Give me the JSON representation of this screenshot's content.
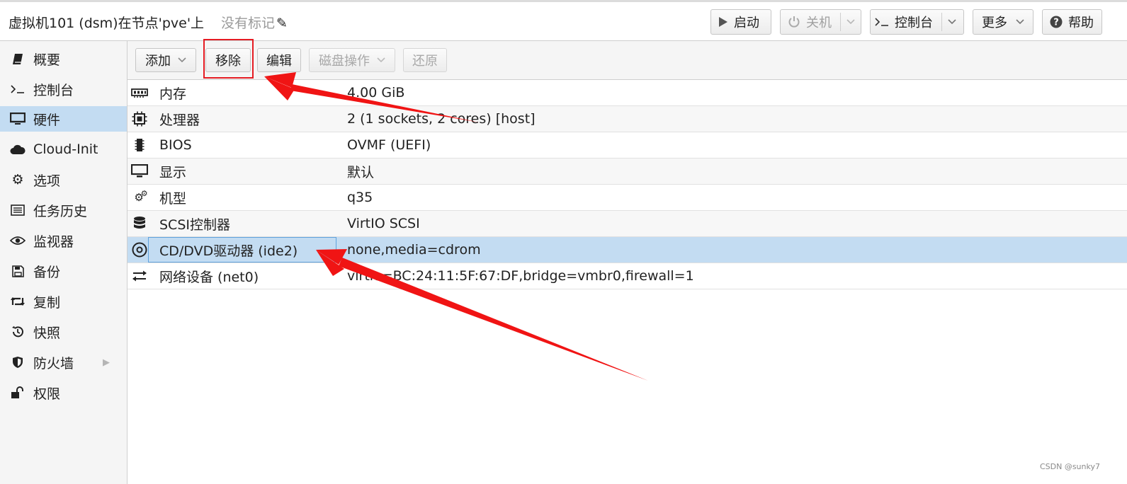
{
  "header": {
    "title": "虚拟机101 (dsm)在节点'pve'上",
    "tags_label": "没有标记",
    "buttons": {
      "start": "启动",
      "shutdown": "关机",
      "console": "控制台",
      "more": "更多",
      "help": "帮助"
    }
  },
  "sidebar": {
    "items": [
      {
        "label": "概要",
        "icon": "book-icon"
      },
      {
        "label": "控制台",
        "icon": "terminal-icon"
      },
      {
        "label": "硬件",
        "icon": "monitor-icon"
      },
      {
        "label": "Cloud-Init",
        "icon": "cloud-icon"
      },
      {
        "label": "选项",
        "icon": "gear-icon"
      },
      {
        "label": "任务历史",
        "icon": "list-icon"
      },
      {
        "label": "监视器",
        "icon": "eye-icon"
      },
      {
        "label": "备份",
        "icon": "floppy-icon"
      },
      {
        "label": "复制",
        "icon": "retweet-icon"
      },
      {
        "label": "快照",
        "icon": "history-icon"
      },
      {
        "label": "防火墙",
        "icon": "shield-icon"
      },
      {
        "label": "权限",
        "icon": "unlock-icon"
      }
    ],
    "active_index": 2
  },
  "toolbar": {
    "add": "添加",
    "remove": "移除",
    "edit": "编辑",
    "disk_action": "磁盘操作",
    "revert": "还原"
  },
  "hardware": [
    {
      "key": "内存",
      "value": "4.00 GiB",
      "icon": "memory-icon"
    },
    {
      "key": "处理器",
      "value": "2 (1 sockets, 2 cores) [host]",
      "icon": "cpu-icon"
    },
    {
      "key": "BIOS",
      "value": "OVMF (UEFI)",
      "icon": "microchip-icon"
    },
    {
      "key": "显示",
      "value": "默认",
      "icon": "desktop-icon"
    },
    {
      "key": "机型",
      "value": "q35",
      "icon": "cogs-icon"
    },
    {
      "key": "SCSI控制器",
      "value": "VirtIO SCSI",
      "icon": "database-icon"
    },
    {
      "key": "CD/DVD驱动器 (ide2)",
      "value": "none,media=cdrom",
      "icon": "cdrom-icon"
    },
    {
      "key": "网络设备 (net0)",
      "value": "virtio=BC:24:11:5F:67:DF,bridge=vmbr0,firewall=1",
      "icon": "exchange-icon"
    }
  ],
  "selected_row": 6,
  "watermark": "CSDN @sunky7",
  "colors": {
    "selection": "#c3dcf2",
    "annotation_red": "#e51c23",
    "selection_border": "#5fa2dd"
  }
}
